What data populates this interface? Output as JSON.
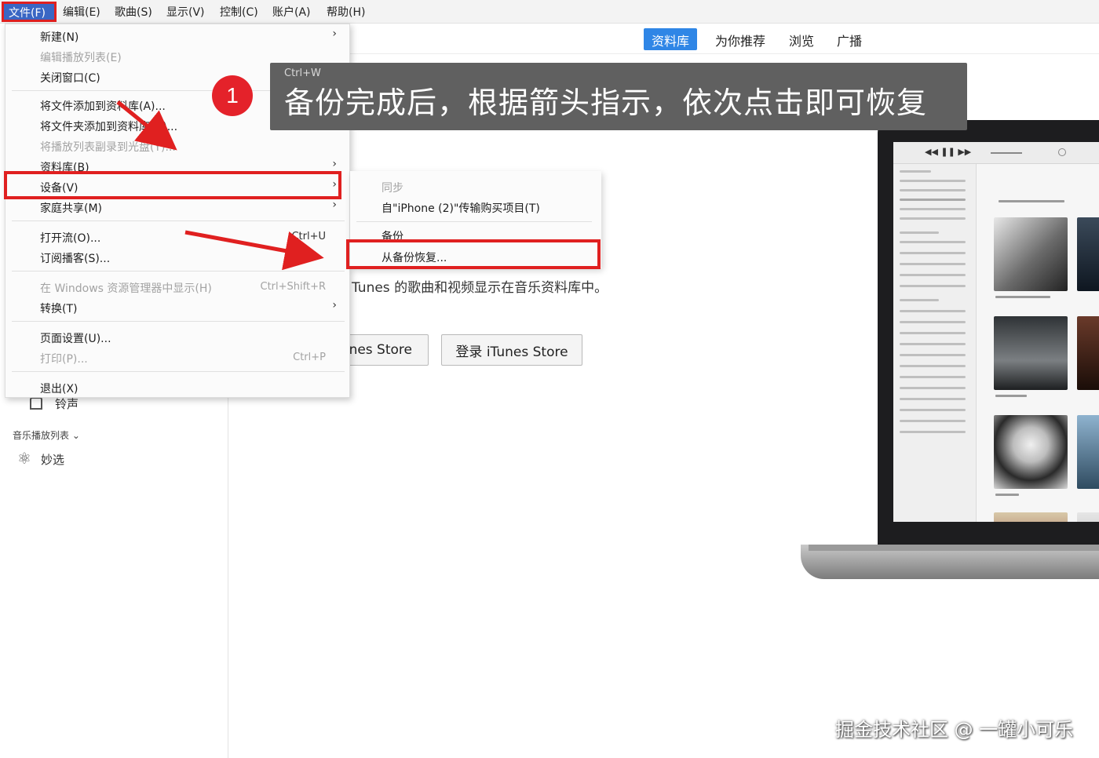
{
  "menubar": {
    "items": [
      "文件(F)",
      "编辑(E)",
      "歌曲(S)",
      "显示(V)",
      "控制(C)",
      "账户(A)",
      "帮助(H)"
    ],
    "active_index": 0
  },
  "tabs": [
    "资料库",
    "为你推荐",
    "浏览",
    "广播"
  ],
  "selected_tab": 0,
  "file_menu": {
    "new": {
      "label": "新建(N)"
    },
    "edit_playlist": {
      "label": "编辑播放列表(E)"
    },
    "close_window": {
      "label": "关闭窗口(C)",
      "shortcut": "Ctrl+W"
    },
    "add_file": {
      "label": "将文件添加到资料库(A)..."
    },
    "add_folder": {
      "label": "将文件夹添加到资料库(D)..."
    },
    "add_playlist_folder": {
      "label": "将播放列表副录到光盘(Y)..."
    },
    "library": {
      "label": "资料库(B)"
    },
    "devices": {
      "label": "设备(V)"
    },
    "home_sharing": {
      "label": "家庭共享(M)"
    },
    "open_stream": {
      "label": "打开流(O)...",
      "shortcut": "Ctrl+U"
    },
    "subscribe_podcast": {
      "label": "订阅播客(S)..."
    },
    "show_in_explorer": {
      "label": "在 Windows 资源管理器中显示(H)",
      "shortcut": "Ctrl+Shift+R"
    },
    "convert": {
      "label": "转换(T)"
    },
    "page_setup": {
      "label": "页面设置(U)..."
    },
    "print": {
      "label": "打印(P)...",
      "shortcut": "Ctrl+P"
    },
    "exit": {
      "label": "退出(X)"
    }
  },
  "devices_submenu": {
    "sync": "同步",
    "transfer": "自\"iPhone (2)\"传输购买项目(T)",
    "backup": "备份",
    "restore": "从备份恢复..."
  },
  "content": {
    "description": "Tunes 的歌曲和视频显示在音乐资料库中。",
    "store_button_1": "nes Store",
    "store_button_2": "登录 iTunes Store"
  },
  "sidebar": {
    "ringtones": "铃声",
    "playlists_header": "音乐播放列表",
    "genius": "妙选"
  },
  "banner": {
    "step": "1",
    "message": "备份完成后，根据箭头指示，依次点击即可恢复"
  },
  "watermark": "掘金技术社区 @ 一罐小可乐",
  "colors": {
    "highlight": "#e02020",
    "tab_selected": "#2f86e6",
    "banner_bg": "#606060",
    "badge": "#e4222a"
  }
}
